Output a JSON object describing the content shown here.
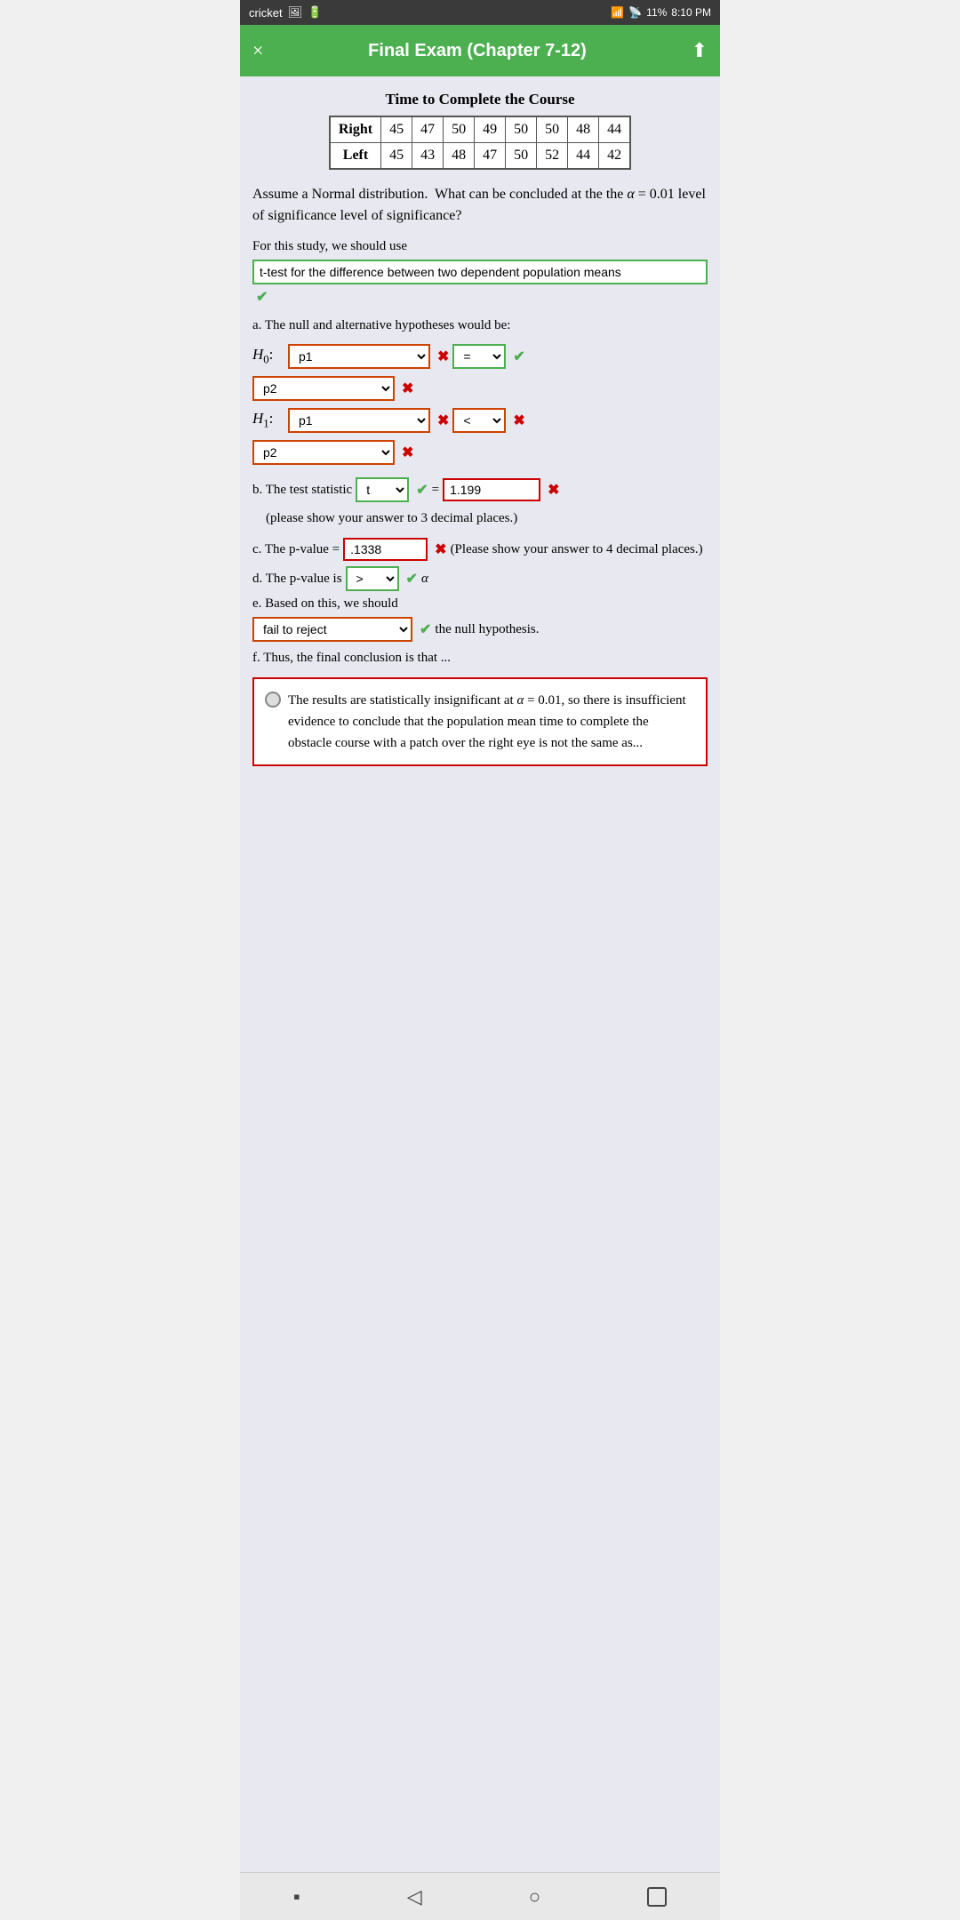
{
  "statusBar": {
    "appName": "cricket",
    "time": "8:10 PM",
    "battery": "11%"
  },
  "header": {
    "title": "Final Exam (Chapter 7-12)",
    "closeLabel": "×",
    "uploadLabel": "⬆"
  },
  "tableSection": {
    "title": "Time to Complete the Course",
    "headers": [
      "Right",
      "Left"
    ],
    "rightValues": [
      "45",
      "47",
      "50",
      "49",
      "50",
      "50",
      "48",
      "44"
    ],
    "leftValues": [
      "45",
      "43",
      "48",
      "47",
      "50",
      "52",
      "44",
      "42"
    ]
  },
  "descriptionText": "Assume a Normal distribution.  What can be concluded at the the α = 0.01 level of significance level of significance?",
  "forStudyText": "For this study, we should use",
  "testTypeOptions": [
    "t-test for the difference between two dependent population means"
  ],
  "testTypeSelected": "t-test for the difference between two dependent population means",
  "hypotheses": {
    "sectionLabel": "a. The null and alternative hypotheses would be:",
    "h0Label": "H₀:",
    "h0Var1": "p1",
    "h0Op": "=",
    "h0Var2": "p2",
    "h1Label": "H₁:",
    "h1Var1": "p1",
    "h1Op": "<",
    "h1Var2": "p2"
  },
  "parts": {
    "b_label": "b. The test statistic",
    "b_stat_select": "t",
    "b_stat_value": "1.199",
    "b_note": "(please show your answer to 3 decimal places.)",
    "c_label": "c. The p-value =",
    "c_value": ".1338",
    "c_note": "(Please show your answer to 4 decimal places.)",
    "d_label": "d. The p-value is",
    "d_op": ">",
    "d_alpha": "α",
    "e_label": "e. Based on this, we should",
    "e_select": "fail to reject",
    "e_rest": "the null hypothesis.",
    "f_label": "f. Thus, the final conclusion is that ...",
    "f_conclusion": "The results are statistically insignificant at α = 0.01, so there is insufficient evidence to conclude that the population mean time to complete the obstacle course with a patch over the right eye is not the same as..."
  }
}
